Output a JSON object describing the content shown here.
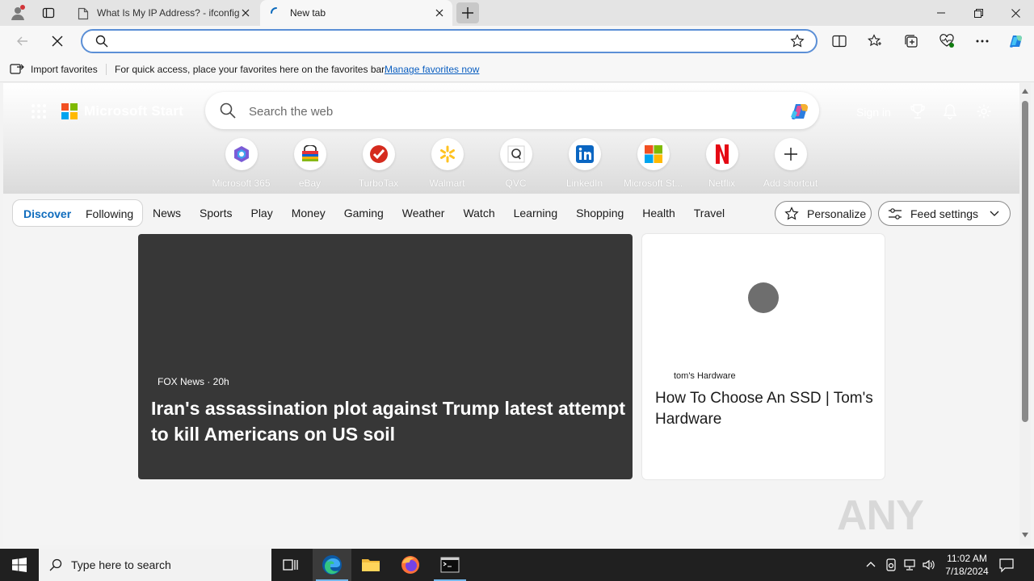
{
  "browser": {
    "tabs": [
      {
        "title": "What Is My IP Address? - ifconfig",
        "active": false
      },
      {
        "title": "New tab",
        "active": true
      }
    ],
    "address_bar": {
      "value": "",
      "placeholder": ""
    },
    "favorites_bar": {
      "import_label": "Import favorites",
      "message": "For quick access, place your favorites here on the favorites bar.",
      "manage_link": "Manage favorites now"
    }
  },
  "newtab": {
    "brand": "Microsoft Start",
    "search_placeholder": "Search the web",
    "signin": "Sign in",
    "shortcuts": [
      {
        "label": "Microsoft 365",
        "icon": "microsoft365-icon"
      },
      {
        "label": "eBay",
        "icon": "ebay-icon"
      },
      {
        "label": "TurboTax",
        "icon": "turbotax-icon"
      },
      {
        "label": "Walmart",
        "icon": "walmart-icon"
      },
      {
        "label": "QVC",
        "icon": "qvc-icon"
      },
      {
        "label": "LinkedIn",
        "icon": "linkedin-icon"
      },
      {
        "label": "Microsoft St...",
        "icon": "microsoft-store-icon"
      },
      {
        "label": "Netflix",
        "icon": "netflix-icon"
      },
      {
        "label": "Add shortcut",
        "icon": "plus-icon"
      }
    ],
    "feed_nav": {
      "discover": "Discover",
      "following": "Following",
      "items": [
        "News",
        "Sports",
        "Play",
        "Money",
        "Gaming",
        "Weather",
        "Watch",
        "Learning",
        "Shopping",
        "Health",
        "Travel"
      ],
      "personalize": "Personalize",
      "feed_settings": "Feed settings"
    },
    "cards": {
      "main": {
        "source": "FOX News · 20h",
        "headline": "Iran's assassination plot against Trump latest attempt to kill Americans on US soil"
      },
      "side": {
        "source": "tom's Hardware",
        "headline": "How To Choose An SSD | Tom's Hardware"
      }
    },
    "watermark": "ANY RUN"
  },
  "taskbar": {
    "search_placeholder": "Type here to search",
    "time": "11:02 AM",
    "date": "7/18/2024"
  },
  "colors": {
    "accent": "#0f6cbd",
    "address_focus": "#5b8fd6",
    "taskbar": "#202020",
    "main_card": "#373737"
  }
}
